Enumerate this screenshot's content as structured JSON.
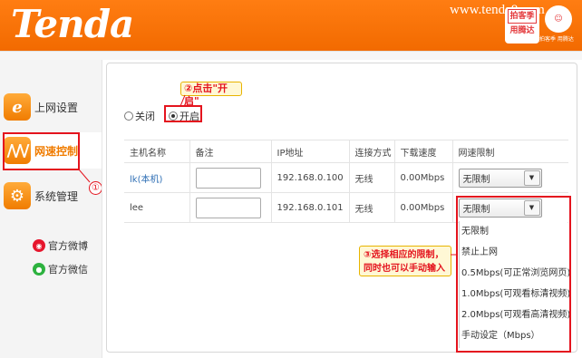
{
  "header": {
    "logo": "Tenda",
    "watermark": "www.tenda8.com",
    "promo_badge_top": "拍客季",
    "promo_badge_bottom": "用腾达",
    "mascot_caption": "拍客季 用腾达",
    "accent_color": "#f26a00"
  },
  "sidebar": {
    "items": [
      {
        "label": "上网设置",
        "icon": "ie-icon"
      },
      {
        "label": "网速控制",
        "icon": "speed-wave-icon"
      },
      {
        "label": "系统管理",
        "icon": "gear-icon"
      }
    ],
    "social": [
      {
        "label": "官方微博",
        "icon": "weibo-icon"
      },
      {
        "label": "官方微信",
        "icon": "wechat-icon"
      }
    ]
  },
  "annotations": {
    "step1": "①",
    "step2": "②点击\"开启\"",
    "step3_line1": "③选择相应的限制，",
    "step3_line2": "同时也可以手动输入"
  },
  "main": {
    "radio_off_label": "关闭",
    "radio_on_label": "开启",
    "table": {
      "headers": [
        "主机名称",
        "备注",
        "IP地址",
        "连接方式",
        "下载速度",
        "网速限制"
      ],
      "rows": [
        {
          "host": "lk(本机)",
          "note": "",
          "ip": "192.168.0.100",
          "conn": "无线",
          "speed": "0.00Mbps",
          "limit": "无限制"
        },
        {
          "host": "lee",
          "note": "",
          "ip": "192.168.0.101",
          "conn": "无线",
          "speed": "0.00Mbps",
          "limit": "无限制"
        }
      ]
    },
    "dropdown_options": [
      "无限制",
      "禁止上网",
      "0.5Mbps(可正常浏览网页)",
      "1.0Mbps(可观看标清视频)",
      "2.0Mbps(可观看高清视频)",
      "手动设定（Mbps）"
    ]
  }
}
